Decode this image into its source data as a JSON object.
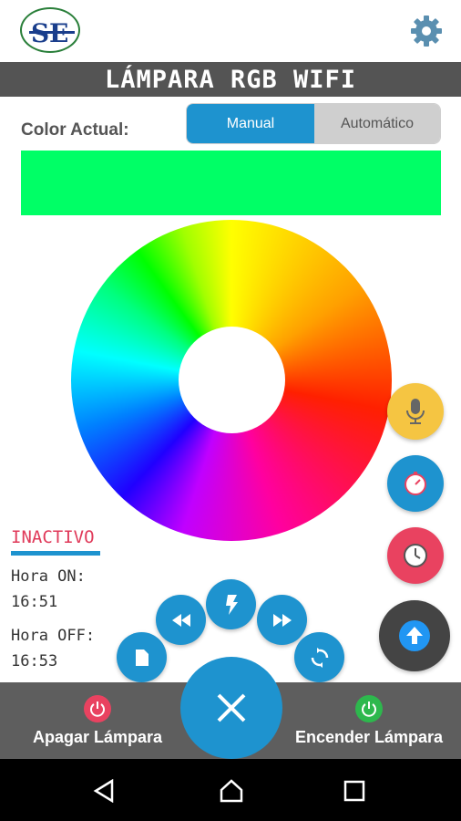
{
  "header": {
    "logo_icon": "se-logo-icon",
    "settings_icon": "gear-icon"
  },
  "title": "LÁMPARA RGB WIFI",
  "color_section": {
    "label": "Color Actual:",
    "current_color": "#00ff66",
    "mode_options": [
      "Manual",
      "Automático"
    ],
    "selected_mode": "Manual"
  },
  "color_wheel": {
    "icon": "color-wheel"
  },
  "status": {
    "state": "INACTIVO",
    "hora_on_label": "Hora ON:",
    "hora_on_value": "16:51",
    "hora_off_label": "Hora OFF:",
    "hora_off_value": "16:53"
  },
  "fabs": {
    "mic_icon": "microphone-icon",
    "timer_icon": "stopwatch-icon",
    "clock_icon": "clock-icon",
    "upload_icon": "upload-arrow-icon"
  },
  "arc_buttons": {
    "file_icon": "file-icon",
    "rewind_icon": "rewind-icon",
    "flash_icon": "flash-icon",
    "forward_icon": "fast-forward-icon",
    "cycle_icon": "refresh-icon"
  },
  "bottom_bar": {
    "off_label": "Apagar Lámpara",
    "on_label": "Encender Lámpara",
    "off_color": "#e94260",
    "on_color": "#2db84d",
    "center_icon": "close-icon"
  },
  "colors": {
    "accent": "#1e93cf",
    "banner": "#545454"
  }
}
